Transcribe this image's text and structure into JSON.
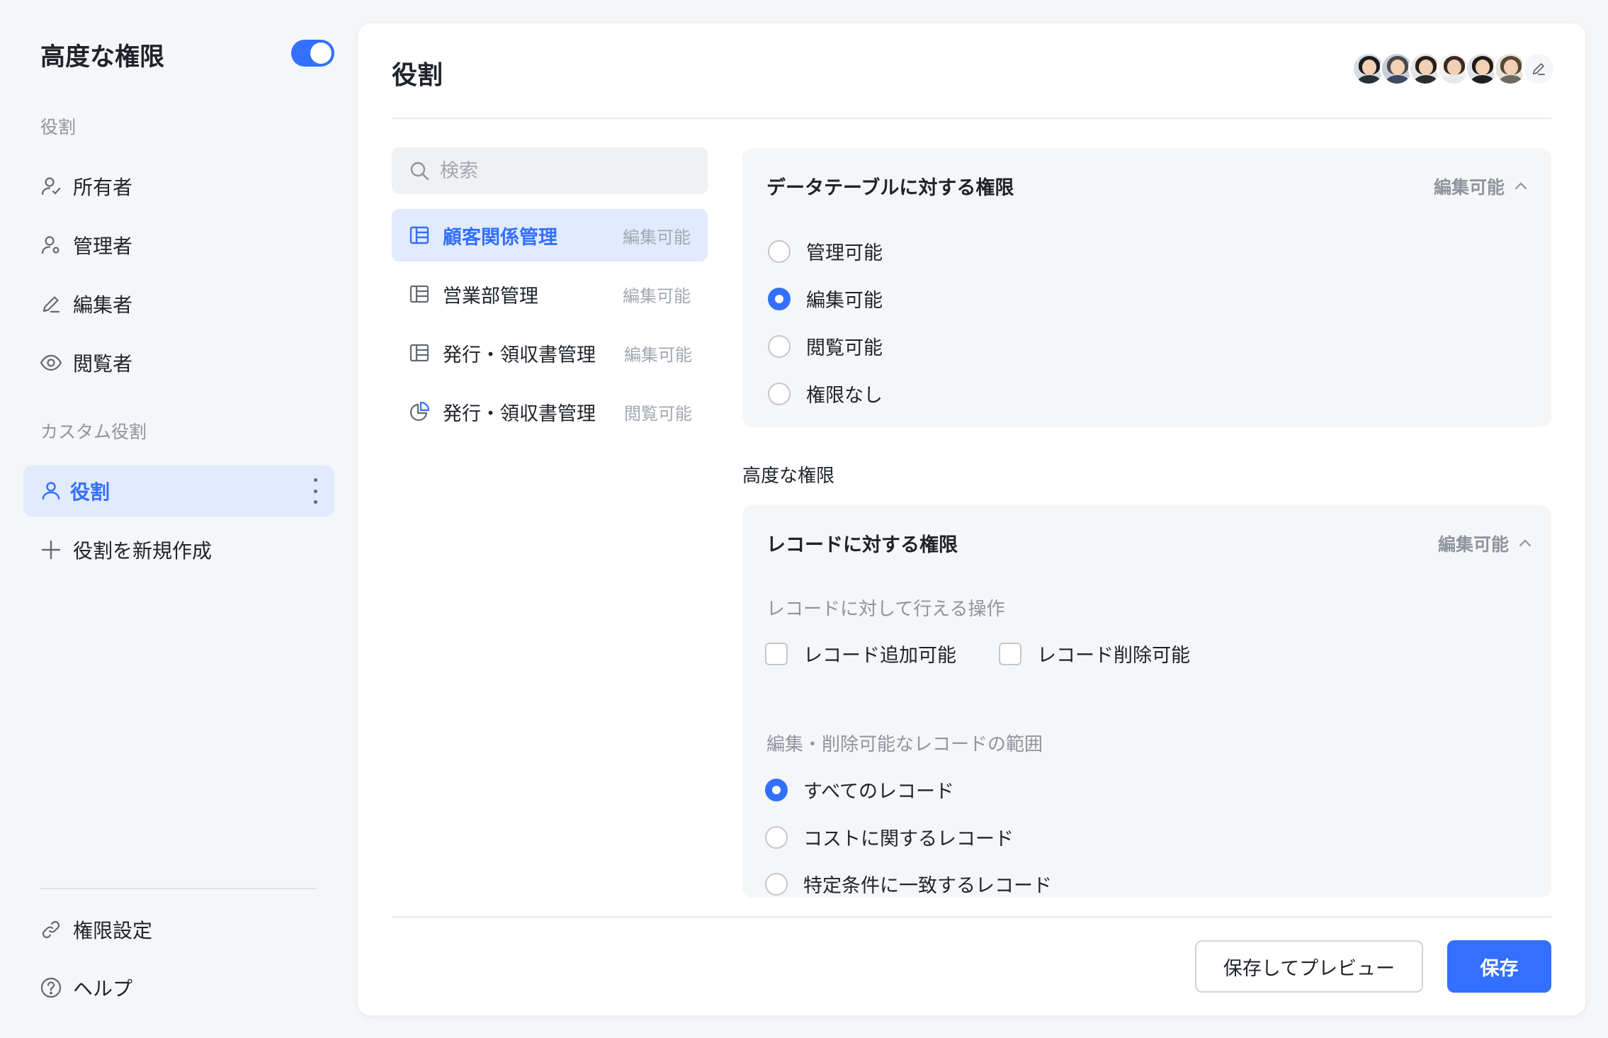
{
  "sidebar": {
    "title": "高度な権限",
    "toggle_on": true,
    "section_roles": "役割",
    "roles": [
      {
        "label": "所有者",
        "icon": "user-check-icon"
      },
      {
        "label": "管理者",
        "icon": "user-settings-icon"
      },
      {
        "label": "編集者",
        "icon": "pencil-icon"
      },
      {
        "label": "閲覧者",
        "icon": "eye-icon"
      }
    ],
    "section_custom": "カスタム役割",
    "custom_role": {
      "label": "役割",
      "icon": "user-icon",
      "active": true
    },
    "new_role": {
      "label": "役割を新規作成",
      "icon": "plus-icon"
    },
    "footer": [
      {
        "label": "権限設定",
        "icon": "link-icon"
      },
      {
        "label": "ヘルプ",
        "icon": "help-circle-icon"
      }
    ]
  },
  "main": {
    "title": "役割",
    "collaborators": [
      "avatar-1",
      "avatar-2",
      "avatar-3",
      "avatar-4",
      "avatar-5",
      "avatar-6"
    ],
    "search": {
      "placeholder": "検索",
      "value": ""
    },
    "tables": [
      {
        "name": "顧客関係管理",
        "perm": "編集可能",
        "icon": "table-icon",
        "active": true
      },
      {
        "name": "営業部管理",
        "perm": "編集可能",
        "icon": "table-icon",
        "active": false
      },
      {
        "name": "発行・領収書管理",
        "perm": "編集可能",
        "icon": "table-icon",
        "active": false
      },
      {
        "name": "発行・領収書管理",
        "perm": "閲覧可能",
        "icon": "dashboard-icon",
        "active": false
      }
    ],
    "table_permissions": {
      "title": "データテーブルに対する権限",
      "current": "編集可能",
      "options": [
        {
          "label": "管理可能",
          "checked": false
        },
        {
          "label": "編集可能",
          "checked": true
        },
        {
          "label": "閲覧可能",
          "checked": false
        },
        {
          "label": "権限なし",
          "checked": false
        }
      ]
    },
    "advanced_label": "高度な権限",
    "record_permissions": {
      "title": "レコードに対する権限",
      "current": "編集可能",
      "operations_label": "レコードに対して行える操作",
      "operations": [
        {
          "label": "レコード追加可能",
          "checked": false
        },
        {
          "label": "レコード削除可能",
          "checked": false
        }
      ],
      "scope_label": "編集・削除可能なレコードの範囲",
      "scope_options": [
        {
          "label": "すべてのレコード",
          "checked": true
        },
        {
          "label": "コストに関するレコード",
          "checked": false
        },
        {
          "label": "特定条件に一致するレコード",
          "checked": false
        }
      ]
    },
    "buttons": {
      "save_preview": "保存してプレビュー",
      "save": "保存"
    }
  },
  "colors": {
    "accent": "#3370ff",
    "active_bg": "#e1eaff",
    "muted_text": "#8f959e",
    "panel_bg": "#f5f6f7"
  }
}
